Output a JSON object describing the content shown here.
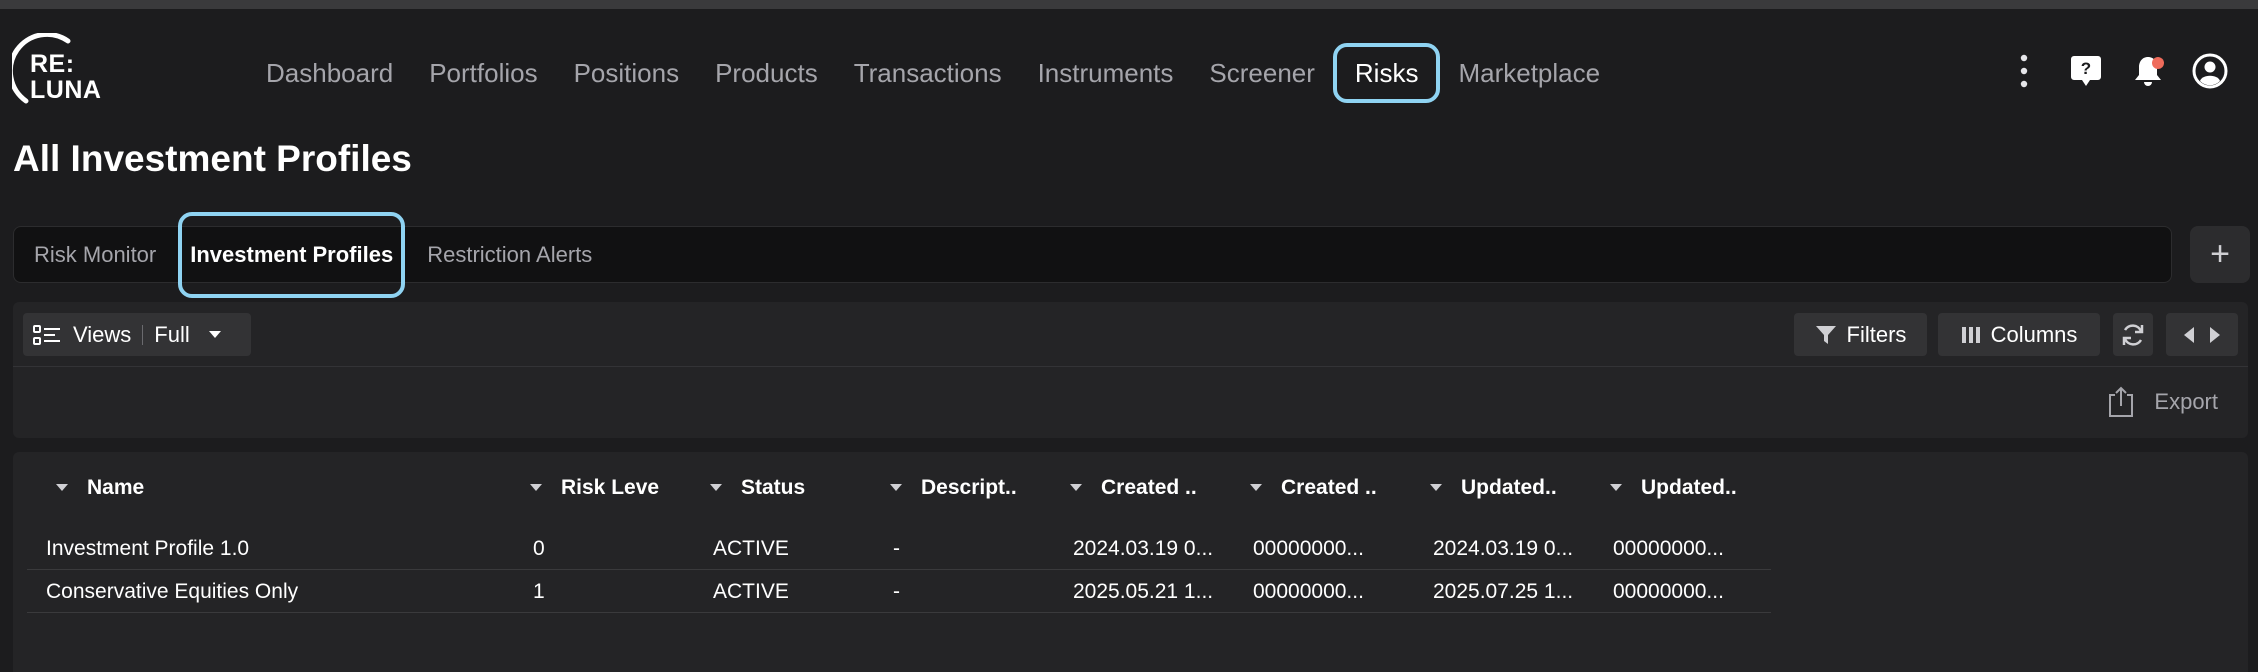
{
  "logo": {
    "text": "RE:\nLUNA",
    "line1": "RE:",
    "line2": "LUNA"
  },
  "nav": {
    "items": [
      {
        "label": "Dashboard"
      },
      {
        "label": "Portfolios"
      },
      {
        "label": "Positions"
      },
      {
        "label": "Products"
      },
      {
        "label": "Transactions"
      },
      {
        "label": "Instruments"
      },
      {
        "label": "Screener"
      },
      {
        "label": "Risks",
        "active": true
      },
      {
        "label": "Marketplace"
      }
    ]
  },
  "header_icons": [
    "more-vertical-icon",
    "help-chat-icon",
    "bell-icon",
    "user-icon"
  ],
  "page_title": "All Investment Profiles",
  "tabs": [
    {
      "label": "Risk Monitor"
    },
    {
      "label": "Investment Profiles",
      "active": true
    },
    {
      "label": "Restriction Alerts"
    }
  ],
  "add_tab_label": "+",
  "toolbar": {
    "views_label": "Views",
    "views_value": "Full",
    "filters_label": "Filters",
    "columns_label": "Columns",
    "export_label": "Export"
  },
  "table": {
    "columns": [
      "Name",
      "Risk Leve",
      "Status",
      "Descript..",
      "Created ..",
      "Created ..",
      "Updated..",
      "Updated.."
    ],
    "rows": [
      [
        "Investment Profile 1.0",
        "0",
        "ACTIVE",
        "-",
        "2024.03.19 0...",
        "00000000...",
        "2024.03.19 0...",
        "00000000..."
      ],
      [
        "Conservative Equities Only",
        "1",
        "ACTIVE",
        "-",
        "2025.05.21 1...",
        "00000000...",
        "2025.07.25 1...",
        "00000000..."
      ]
    ]
  },
  "colors": {
    "background": "#1c1c1e",
    "panel": "#242426",
    "highlight": "#8fd3f2",
    "notification": "#ef6b5b",
    "muted_text": "#a5a5ab"
  }
}
